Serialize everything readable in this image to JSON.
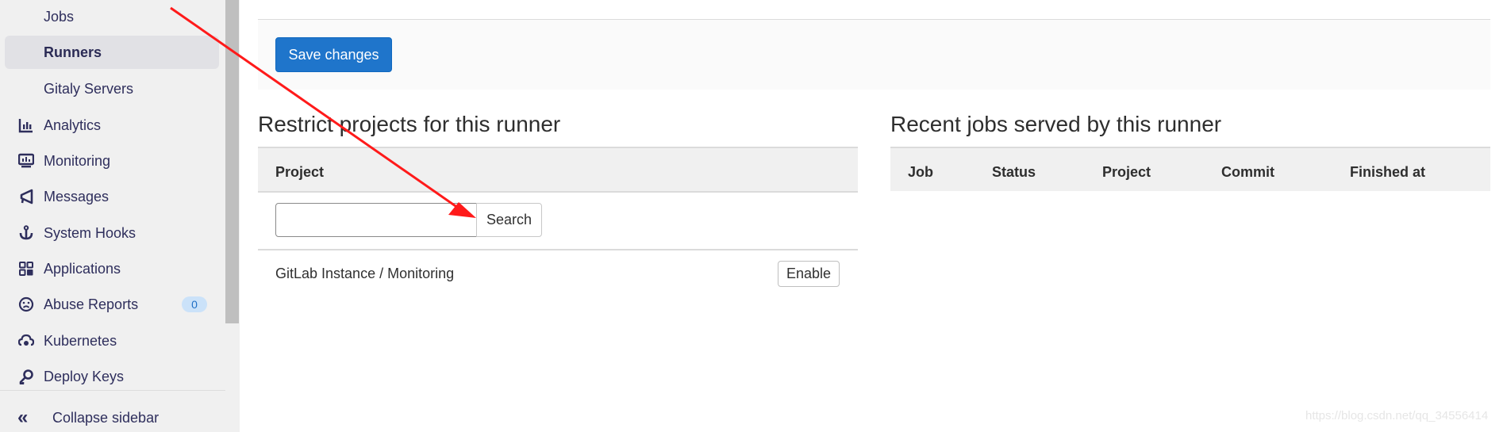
{
  "sidebar": {
    "items": [
      {
        "label": "Jobs",
        "icon": null,
        "active": false
      },
      {
        "label": "Runners",
        "icon": null,
        "active": true
      },
      {
        "label": "Gitaly Servers",
        "icon": null,
        "active": false
      },
      {
        "label": "Analytics",
        "icon": "chart-icon",
        "active": false
      },
      {
        "label": "Monitoring",
        "icon": "monitor-icon",
        "active": false
      },
      {
        "label": "Messages",
        "icon": "megaphone-icon",
        "active": false
      },
      {
        "label": "System Hooks",
        "icon": "anchor-icon",
        "active": false
      },
      {
        "label": "Applications",
        "icon": "grid-icon",
        "active": false
      },
      {
        "label": "Abuse Reports",
        "icon": "sad-face-icon",
        "active": false,
        "badge": "0"
      },
      {
        "label": "Kubernetes",
        "icon": "cloud-gear-icon",
        "active": false
      },
      {
        "label": "Deploy Keys",
        "icon": "key-icon",
        "active": false
      }
    ],
    "collapse_label": "Collapse sidebar",
    "collapse_icon": "«"
  },
  "form": {
    "save_label": "Save changes"
  },
  "restrict": {
    "title": "Restrict projects for this runner",
    "column_header": "Project",
    "search_value": "",
    "search_button": "Search",
    "projects": [
      {
        "name": "GitLab Instance / Monitoring",
        "action": "Enable"
      }
    ]
  },
  "recent_jobs": {
    "title": "Recent jobs served by this runner",
    "columns": [
      "Job",
      "Status",
      "Project",
      "Commit",
      "Finished at"
    ]
  },
  "colors": {
    "primary": "#1f75cb",
    "annotation_arrow": "#ff1a1a",
    "badge_bg": "#cbe2f9"
  },
  "watermark": "https://blog.csdn.net/qq_34556414"
}
